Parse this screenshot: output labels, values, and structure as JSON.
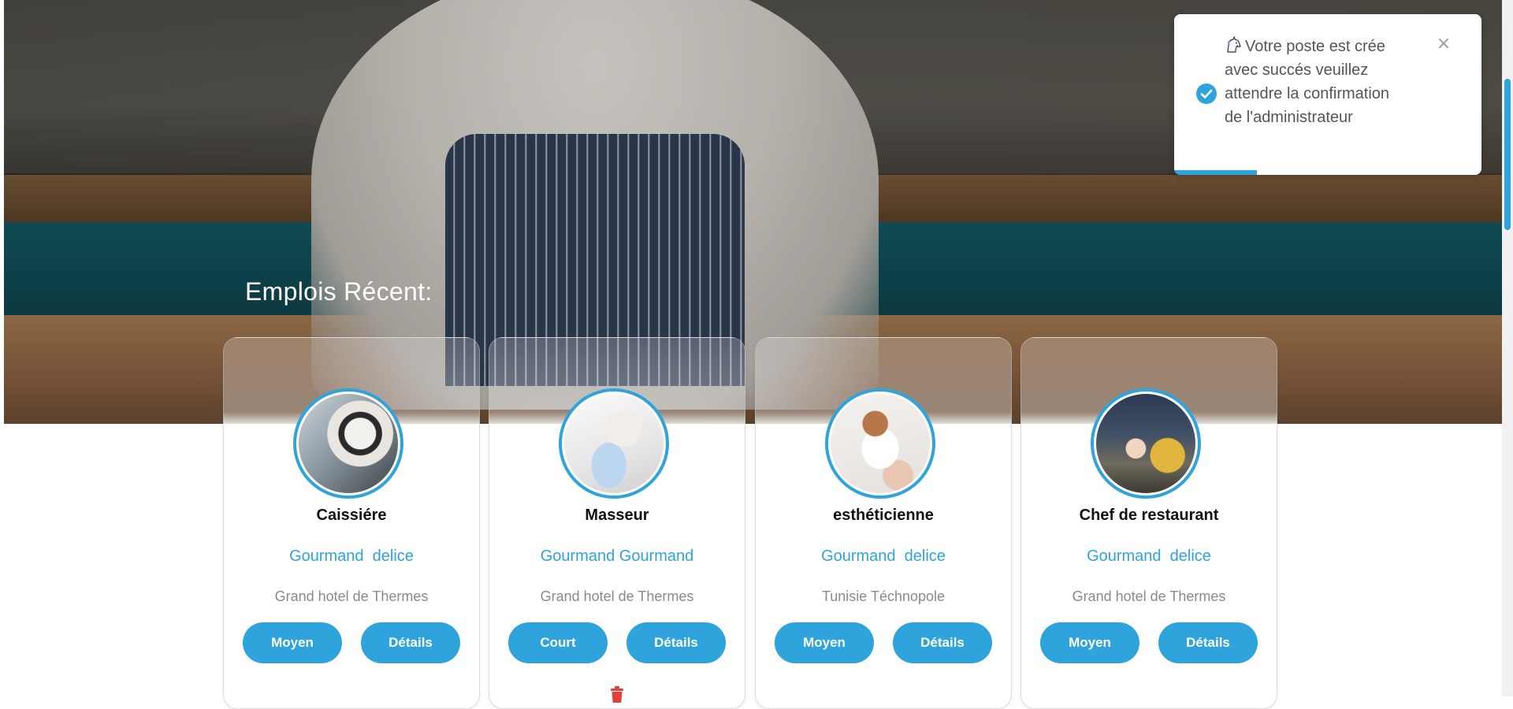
{
  "section": {
    "title": "Emplois Récent:"
  },
  "jobs": [
    {
      "title": "Caissiére",
      "company": "Gourmand  delice",
      "location": "Grand hotel de Thermes",
      "duration_button": "Moyen",
      "details_button": "Détails",
      "photo_icon": "cashier-photo"
    },
    {
      "title": "Masseur",
      "company": "Gourmand Gourmand",
      "location": "Grand hotel de Thermes",
      "duration_button": "Court",
      "details_button": "Détails",
      "photo_icon": "masseur-photo",
      "delete_icon": "trash-icon"
    },
    {
      "title": "esthéticienne",
      "company": "Gourmand  delice",
      "location": "Tunisie Téchnopole",
      "duration_button": "Moyen",
      "details_button": "Détails",
      "photo_icon": "beautician-photo"
    },
    {
      "title": "Chef de restaurant",
      "company": "Gourmand  delice",
      "location": "Grand hotel de Thermes",
      "duration_button": "Moyen",
      "details_button": "Détails",
      "photo_icon": "restaurant-chef-photo"
    }
  ],
  "toast": {
    "message": "Votre poste est crée avec succés veuillez attendre la confirmation de l'administrateur",
    "status_icon": "check-circle-icon",
    "emoji_icon": "unicorn-emoji-icon",
    "close_label": "×",
    "progress_fraction": 0.27
  },
  "colors": {
    "accent": "#2ea3dc",
    "delete": "#e0413b",
    "heading_on_hero": "#ffffff"
  }
}
